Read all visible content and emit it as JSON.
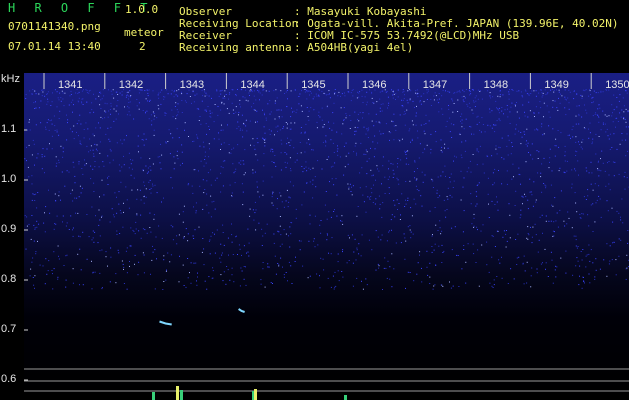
{
  "app": {
    "title": "H R O F F T",
    "version": "1.0.0"
  },
  "file": {
    "name": "0701141340.png",
    "datetime": "07.01.14 13:40"
  },
  "meteor": {
    "label": "meteor",
    "count": "2"
  },
  "info": [
    {
      "label": "Observer",
      "value": ": Masayuki Kobayashi"
    },
    {
      "label": "Receiving Location",
      "value": ": Ogata-vill. Akita-Pref. JAPAN (139.96E, 40.02N)"
    },
    {
      "label": "Receiver",
      "value": ": ICOM IC-575 53.7492(@LCD)MHz USB"
    },
    {
      "label": "Receiving antenna",
      "value": ": A504HB(yagi 4el)"
    }
  ],
  "chart_data": {
    "type": "heatmap",
    "title": "",
    "xlabel": "",
    "ylabel": "kHz",
    "x_ticks": [
      "1341",
      "1342",
      "1343",
      "1344",
      "1345",
      "1346",
      "1347",
      "1348",
      "1349",
      "1350"
    ],
    "y_ticks": [
      "1.1",
      "1.0",
      "0.9",
      "0.8",
      "0.7",
      "0.6"
    ],
    "ylim": [
      0.56,
      1.19
    ],
    "meteor_echoes": [
      {
        "x_min": 1342.9,
        "x_max": 1343.1,
        "y_khz": 0.715
      },
      {
        "x_min": 1344.2,
        "x_max": 1344.3,
        "y_khz": 0.74
      }
    ],
    "colors": {
      "noise": "#3a44ff",
      "echo": "#7fd7ff",
      "grid": "#9a9a9a"
    }
  }
}
